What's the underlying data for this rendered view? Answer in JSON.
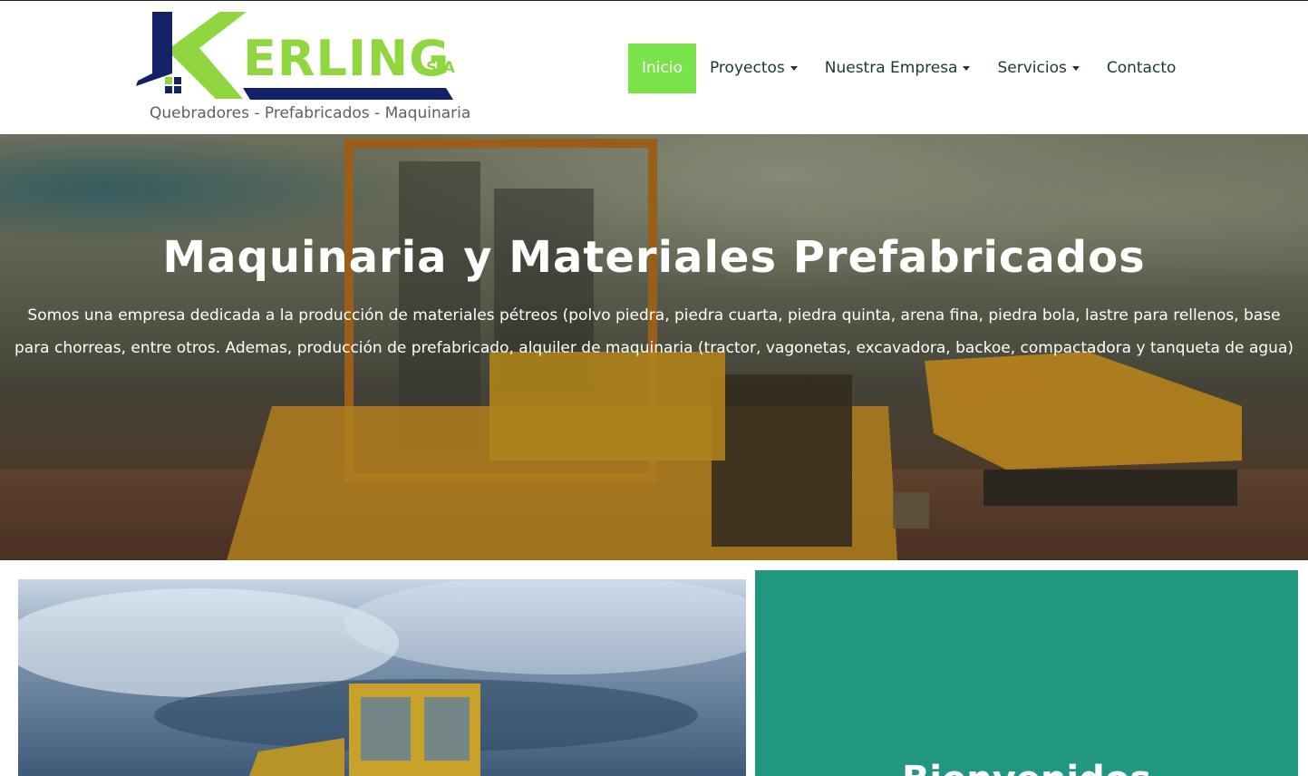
{
  "brand": {
    "name": "ERLING",
    "suffix": "S.A",
    "tagline": "Quebradores - Prefabricados - Maquinaria",
    "colors": {
      "green": "#8fd63f",
      "navy": "#142167"
    }
  },
  "nav": {
    "items": [
      {
        "label": "Inicio",
        "active": true,
        "dropdown": false
      },
      {
        "label": "Proyectos",
        "active": false,
        "dropdown": true
      },
      {
        "label": "Nuestra Empresa",
        "active": false,
        "dropdown": true
      },
      {
        "label": "Servicios",
        "active": false,
        "dropdown": true
      },
      {
        "label": "Contacto",
        "active": false,
        "dropdown": false
      }
    ],
    "active_color": "#7be34a"
  },
  "hero": {
    "title": "Maquinaria y Materiales Prefabricados",
    "text": "Somos una empresa dedicada a la producción de materiales pétreos  (polvo piedra, piedra cuarta, piedra quinta, arena fina, piedra bola, lastre para rellenos, base para chorreas, entre otros. Ademas, producción de prefabricado, alquiler de maquinaria (tractor, vagonetas, excavadora, backoe, compactadora y tanqueta de agua)"
  },
  "section": {
    "panel_heading": "Bienvenidos",
    "panel_color": "#22977f"
  }
}
